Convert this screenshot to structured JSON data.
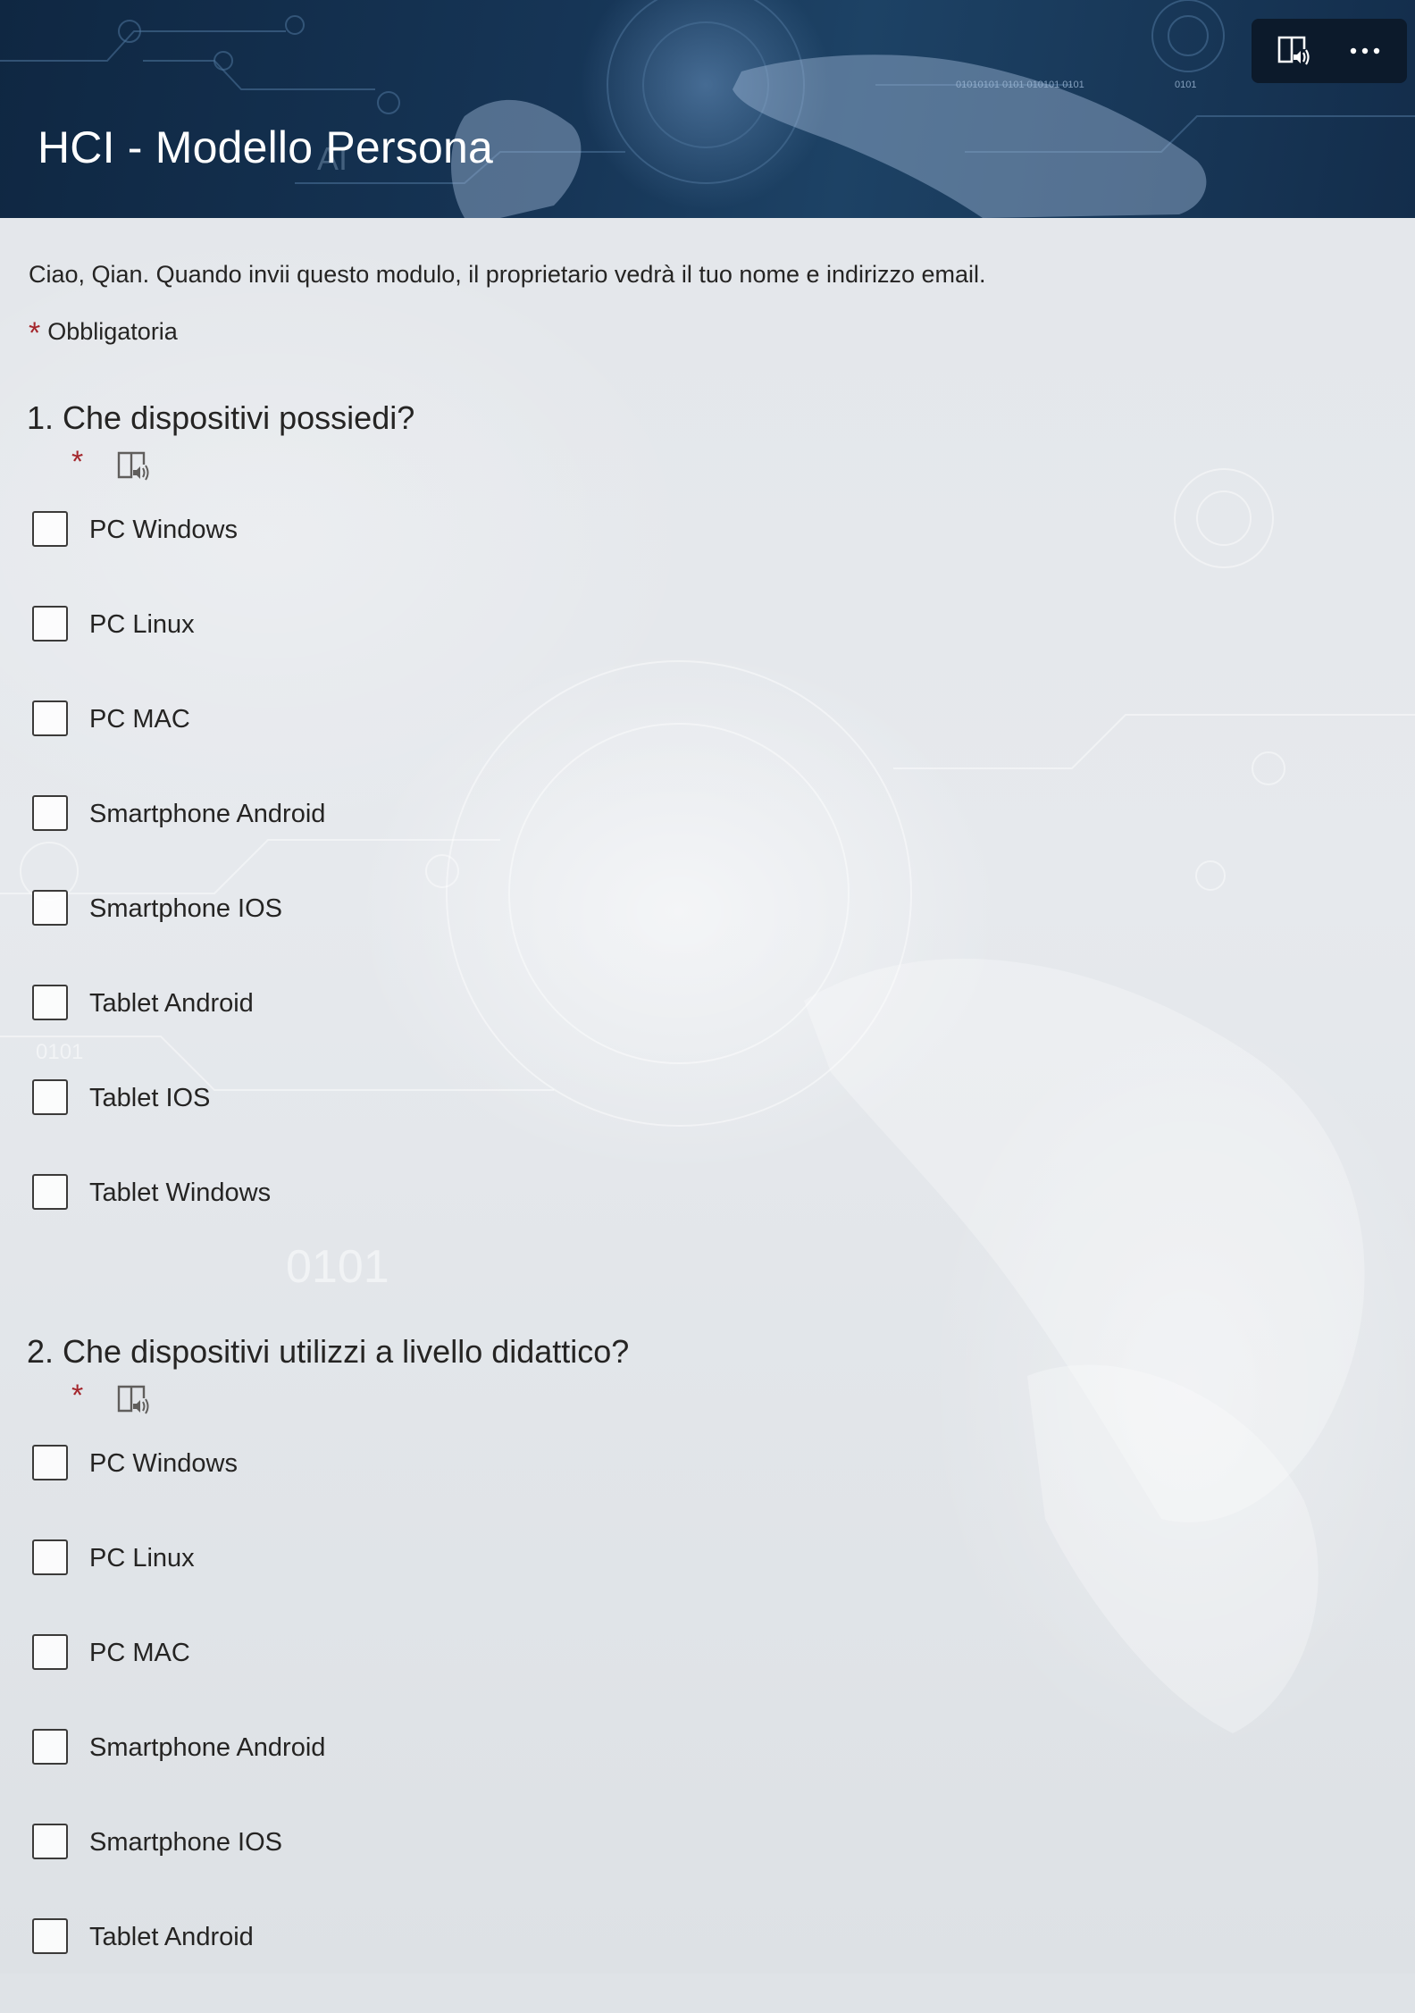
{
  "header": {
    "title": "HCI - Modello Persona",
    "toolbar": {
      "immersive_reader_icon": "immersive-reader-icon",
      "more_icon": "more-options-icon"
    }
  },
  "intro": {
    "text": "Ciao, Qian. Quando invii questo modulo, il proprietario vedrà il tuo nome e indirizzo email.",
    "required_star": "*",
    "required_label": "Obbligatoria"
  },
  "questions": [
    {
      "number": "1.",
      "title": "Che dispositivi possiedi?",
      "required_star": "*",
      "options": [
        {
          "label": "PC Windows",
          "checked": false
        },
        {
          "label": "PC Linux",
          "checked": false
        },
        {
          "label": "PC MAC",
          "checked": false
        },
        {
          "label": "Smartphone Android",
          "checked": false
        },
        {
          "label": "Smartphone IOS",
          "checked": false
        },
        {
          "label": "Tablet Android",
          "checked": false
        },
        {
          "label": "Tablet IOS",
          "checked": false
        },
        {
          "label": "Tablet Windows",
          "checked": false
        }
      ]
    },
    {
      "number": "2.",
      "title": "Che dispositivi utilizzi a livello didattico?",
      "required_star": "*",
      "options": [
        {
          "label": "PC Windows",
          "checked": false
        },
        {
          "label": "PC Linux",
          "checked": false
        },
        {
          "label": "PC MAC",
          "checked": false
        },
        {
          "label": "Smartphone Android",
          "checked": false
        },
        {
          "label": "Smartphone IOS",
          "checked": false
        },
        {
          "label": "Tablet Android",
          "checked": false
        }
      ]
    }
  ],
  "colors": {
    "header_bg": "#163556",
    "required": "#a4262c",
    "text": "#252423",
    "page_bg": "#e3e6ea"
  }
}
